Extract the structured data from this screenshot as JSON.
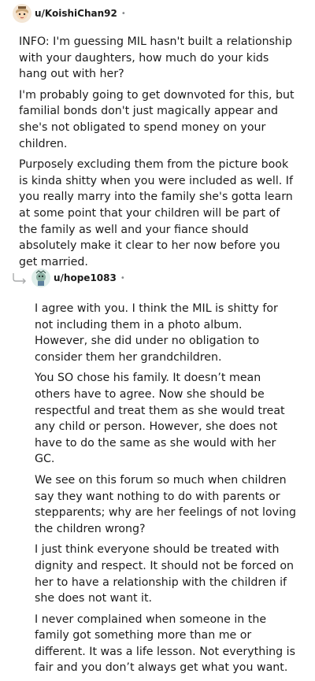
{
  "comments": [
    {
      "username": "u/KoishiChan92",
      "meta": "•",
      "avatar": "avatar",
      "paragraphs": [
        "INFO: I'm guessing MIL hasn't built a relationship with your daughters, how much do your kids hang out with her?",
        "I'm probably going to get downvoted for this, but familial bonds don't just magically appear and she's not obligated to spend money on your children.",
        "Purposely excluding them from the picture book is kinda shitty when you were included as well. If you really marry into the family she's gotta learn at some point that your children will be part of the family as well and your fiance should absolutely make it clear to her now before you get married."
      ]
    },
    {
      "username": "u/hope1083",
      "meta": "•",
      "avatar": "avatar",
      "reply_icon": "reply-arrow-icon",
      "paragraphs": [
        "I agree with you. I think the MIL is shitty for not including them in a photo album. However, she did under no obligation to consider them her grandchildren.",
        "You SO chose his family. It doesn’t mean others have to agree. Now she should be respectful and treat them as she would treat any child or person. However, she does not have to do the same as she would with her GC.",
        "We see on this forum so much when children say they want nothing to do with parents or stepparents; why are her feelings of not loving the children wrong?",
        "I just think everyone should be treated with dignity and respect. It should not be forced on her to have a relationship with the children if she does not want it.",
        "I never complained when someone in the family got something more than me or different. It was a life lesson. Not everything is fair and you don’t always get what you want."
      ]
    }
  ]
}
